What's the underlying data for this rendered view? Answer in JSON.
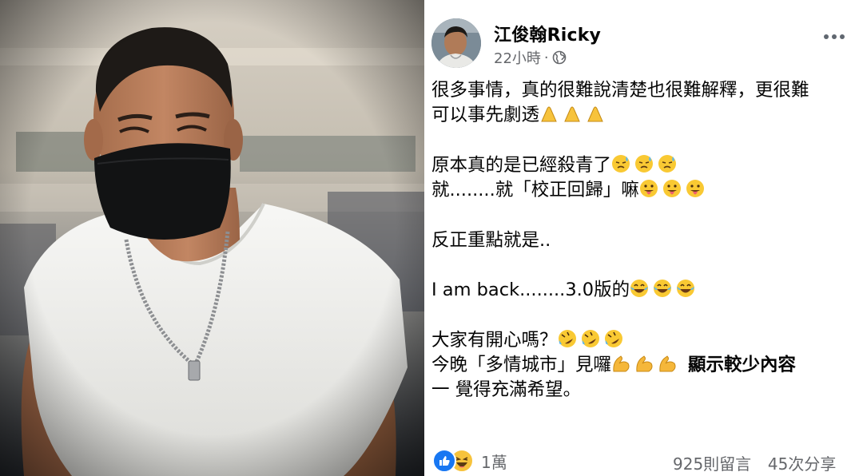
{
  "post": {
    "author": "江俊翰Ricky",
    "time": "22小時",
    "time_separator": "·",
    "privacy_icon": "globe-icon",
    "more_icon": "ellipsis-icon",
    "lines": {
      "l1": "很多事情，真的很難說清楚也很難解釋，更很難",
      "l2": "可以事先劇透",
      "l3": "原本真的是已經殺青了",
      "l4": "就........就「校正回歸」嘛",
      "l5": "反正重點就是..",
      "l6": "I am back........3.0版的",
      "l7": "大家有開心嗎？",
      "l8": "今晚「多情城市」見囉",
      "l9": "一 覺得充滿希望。"
    },
    "see_more": "顯示較少內容",
    "emojis": {
      "pray": "folded-hands-emoji",
      "sweat": "downcast-sweat-emoji",
      "tongue": "tongue-out-emoji",
      "joy": "tears-of-joy-emoji",
      "rofl": "rolling-laughing-emoji",
      "muscle": "flexed-biceps-emoji"
    },
    "reactions": {
      "icons": [
        "like-icon",
        "haha-icon"
      ],
      "count": "1萬",
      "like_color": "#1877f2"
    },
    "stats": {
      "comments": "925則留言",
      "shares": "45次分享"
    }
  },
  "photo": {
    "subject": "man in black face mask and white t-shirt with chain necklace"
  }
}
